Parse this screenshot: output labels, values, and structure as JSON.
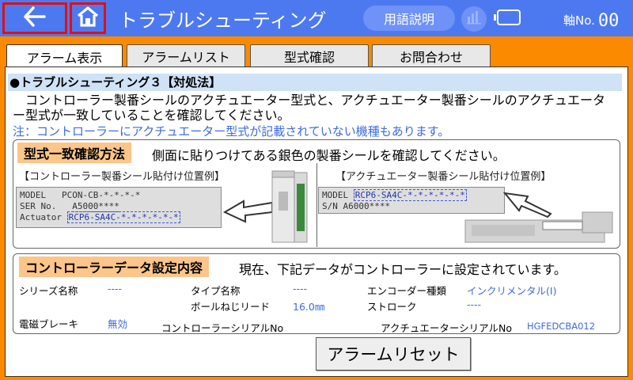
{
  "header": {
    "title": "トラブルシューティング",
    "glossary_label": "用語説明",
    "axis_label": "軸No.",
    "axis_value": "00",
    "bg_color": "#4d79f0"
  },
  "tabs": [
    {
      "label": "アラーム表示",
      "active": true
    },
    {
      "label": "アラームリスト"
    },
    {
      "label": "型式確認"
    },
    {
      "label": "お問合わせ"
    }
  ],
  "section": {
    "title": "●トラブルシューティング３【対処法】",
    "description": "コントローラー製番シールのアクチュエーター型式と、アクチュエーター製番シールのアクチュエーター型式が一致していることを確認してください。",
    "note": "注：コントローラーにアクチュエーター型式が記載されていない機種もあります。"
  },
  "method": {
    "tag": "型式一致確認方法",
    "text": "側面に貼りつけてある銀色の製番シールを確認してください。",
    "controller_caption": "【コントローラー製番シール貼付け位置例】",
    "actuator_caption": "【アクチュエーター製番シール貼付け位置例】",
    "controller_label": {
      "model_key": "MODEL",
      "model_val": "PCON-CB-*-*-*-*",
      "ser_key": "SER No.",
      "ser_val": "A5000****",
      "actuator_key": "Actuator",
      "actuator_val": "RCP6-SA4C-*-*-*-*-*-*"
    },
    "actuator_label": {
      "model_key": "MODEL",
      "model_val": "RCP6-SA4C-*-*-*-*-*-*",
      "sn_key": "S/N",
      "sn_val": "A6000****"
    }
  },
  "data_settings": {
    "tag": "コントローラーデータ設定内容",
    "text": "現在、下記データがコントローラーに設定されています。",
    "series_name_label": "シリーズ名称",
    "series_name_value": "----",
    "type_name_label": "タイプ名称",
    "type_name_value": "----",
    "encoder_label": "エンコーダー種類",
    "encoder_value": "インクリメンタル(I)",
    "ballscrew_label": "ボールねじリード",
    "ballscrew_value": "16.0㎜",
    "stroke_label": "ストローク",
    "stroke_value": "----",
    "brake_label": "電磁ブレーキ",
    "brake_value": "無効",
    "controller_serial_label": "コントローラーシリアルNo",
    "controller_serial_value": "",
    "actuator_serial_label": "アクチュエーターシリアルNo",
    "actuator_serial_value": "HGFEDCBA012"
  },
  "reset_label": "アラームリセット",
  "colors": {
    "accent_orange": "#fb8a00",
    "tag_bg": "#fcc58a",
    "value_blue": "#3c6be0",
    "highlight_red": "#e01010"
  }
}
